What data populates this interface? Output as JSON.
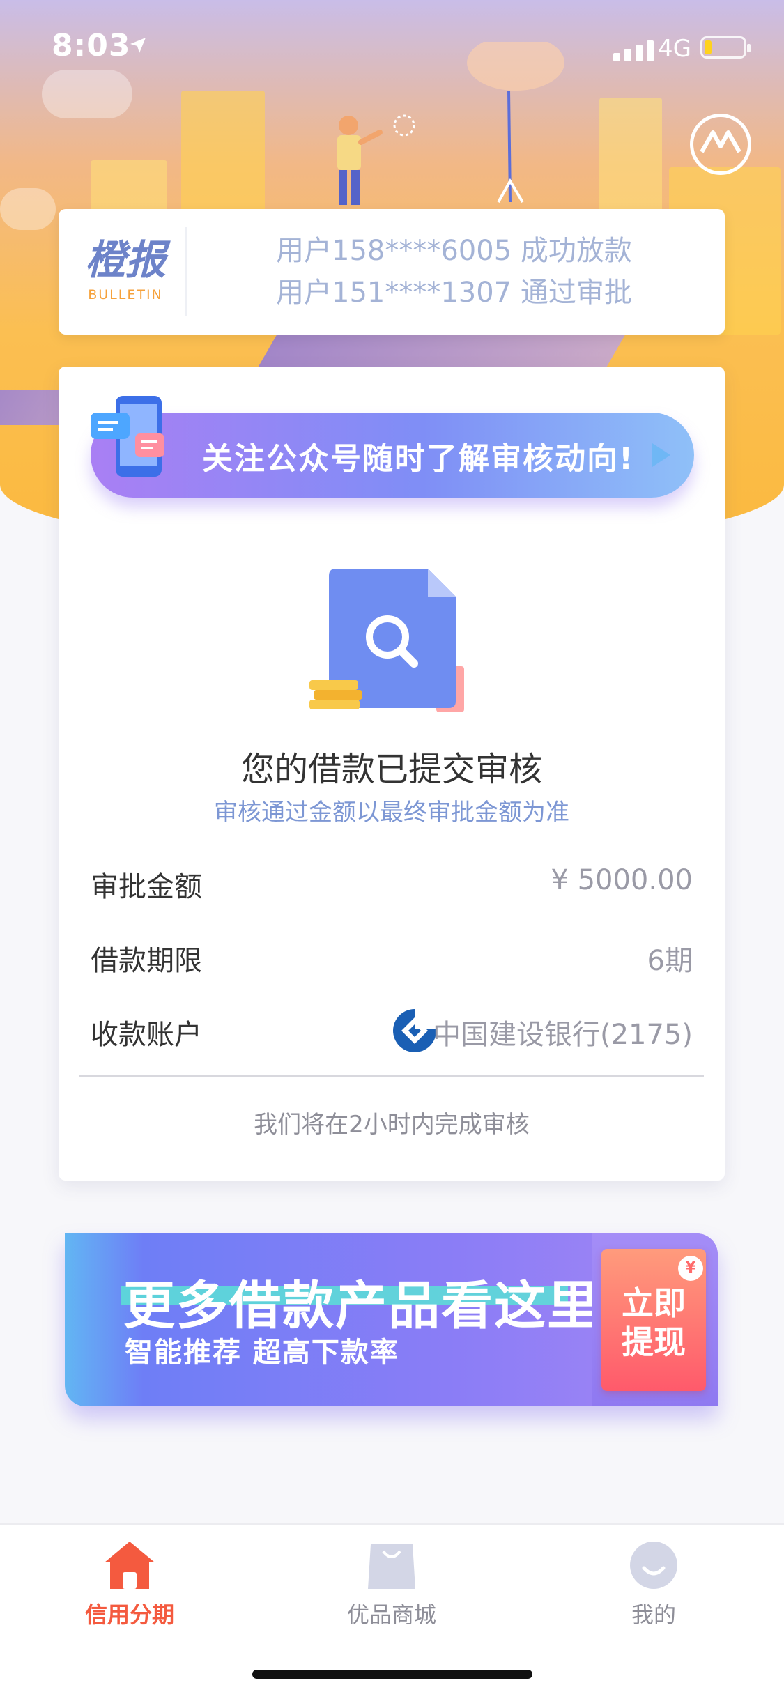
{
  "status_bar": {
    "time": "8:03",
    "network": "4G"
  },
  "bulletin": {
    "logo_cn": "橙报",
    "logo_en": "BULLETIN",
    "lines": [
      "用户158****6005 成功放款",
      "用户151****1307 通过审批"
    ]
  },
  "follow_banner": {
    "label": "关注公众号随时了解审核动向!"
  },
  "review": {
    "title": "您的借款已提交审核",
    "subtitle": "审核通过金额以最终审批金额为准",
    "rows": [
      {
        "label": "审批金额",
        "value": "¥ 5000.00"
      },
      {
        "label": "借款期限",
        "value": "6期"
      },
      {
        "label": "收款账户",
        "value": "中国建设银行(2175)"
      }
    ],
    "note": "我们将在2小时内完成审核"
  },
  "promo": {
    "headline": "更多借款产品看这里",
    "tagline": "智能推荐 超高下款率",
    "cta_line1": "立即",
    "cta_line2": "提现",
    "coin_symbol": "¥"
  },
  "tabbar": {
    "items": [
      {
        "label": "信用分期",
        "icon": "home-icon",
        "active": true
      },
      {
        "label": "优品商城",
        "icon": "shopping-bag-icon",
        "active": false
      },
      {
        "label": "我的",
        "icon": "profile-icon",
        "active": false
      }
    ]
  },
  "colors": {
    "active_tab": "#f45a3f",
    "inactive_tab": "#8e8e98",
    "accent_blue": "#7d97d4"
  }
}
